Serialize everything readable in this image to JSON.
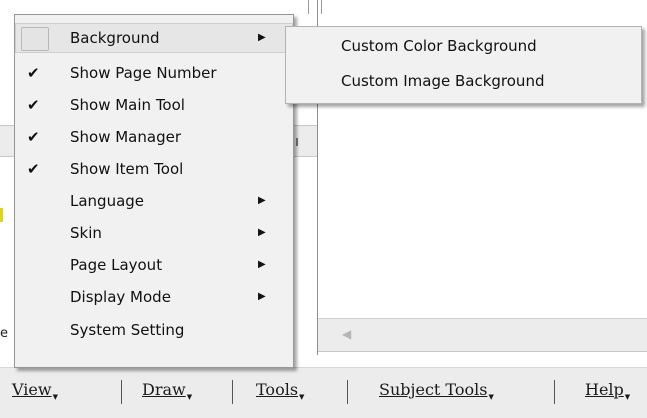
{
  "menubar": {
    "items": [
      {
        "label": "View"
      },
      {
        "label": "Draw"
      },
      {
        "label": "Tools"
      },
      {
        "label": "Subject Tools"
      },
      {
        "label": "Help"
      }
    ]
  },
  "view_menu": {
    "items": [
      {
        "label": "Background",
        "checked": false,
        "submenu": true,
        "highlighted": true
      },
      {
        "label": "Show Page Number",
        "checked": true,
        "submenu": false
      },
      {
        "label": "Show Main Tool",
        "checked": true,
        "submenu": false
      },
      {
        "label": "Show Manager",
        "checked": true,
        "submenu": false
      },
      {
        "label": "Show Item Tool",
        "checked": true,
        "submenu": false
      },
      {
        "label": "Language",
        "checked": false,
        "submenu": true
      },
      {
        "label": "Skin",
        "checked": false,
        "submenu": true
      },
      {
        "label": "Page Layout",
        "checked": false,
        "submenu": true
      },
      {
        "label": "Display Mode",
        "checked": false,
        "submenu": true
      },
      {
        "label": "System Setting",
        "checked": false,
        "submenu": false
      }
    ],
    "check_glyph": "✔",
    "submenu_glyph": "▶"
  },
  "background_submenu": {
    "items": [
      {
        "label": "Custom Color Background"
      },
      {
        "label": "Custom Image Background"
      }
    ]
  },
  "background_text": {
    "e_char": "e"
  },
  "icons": {
    "check": "check-icon",
    "submenu_arrow": "submenu-arrow-icon",
    "dropdown_arrow": "dropdown-triangle-icon",
    "scroll_left": "scroll-left-arrow-icon"
  }
}
